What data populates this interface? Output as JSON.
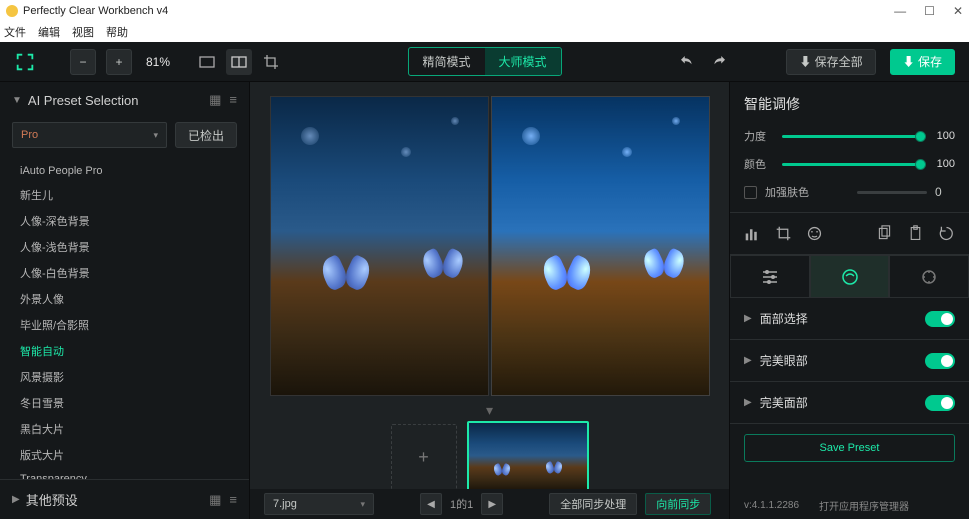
{
  "window": {
    "title": "Perfectly Clear Workbench v4"
  },
  "menubar": [
    "文件",
    "编辑",
    "视图",
    "帮助"
  ],
  "toolbar": {
    "zoom": "81%",
    "mode_simple": "精简模式",
    "mode_master": "大师模式",
    "save_all": "⬇ 保存全部",
    "save": "⬇ 保存"
  },
  "left": {
    "ai_title": "AI Preset Selection",
    "dropdown_value": "Pro",
    "detect_btn": "已检出",
    "presets": [
      {
        "label": "iAuto People Pro",
        "sel": false
      },
      {
        "label": "新生儿",
        "sel": false
      },
      {
        "label": "人像-深色背景",
        "sel": false
      },
      {
        "label": "人像-浅色背景",
        "sel": false
      },
      {
        "label": "人像-白色背景",
        "sel": false
      },
      {
        "label": "外景人像",
        "sel": false
      },
      {
        "label": "毕业照/合影照",
        "sel": false
      },
      {
        "label": "智能自动",
        "sel": true
      },
      {
        "label": "风景摄影",
        "sel": false
      },
      {
        "label": "冬日雪景",
        "sel": false
      },
      {
        "label": "黑白大片",
        "sel": false
      },
      {
        "label": "版式大片",
        "sel": false
      },
      {
        "label": "Transparency",
        "sel": false
      }
    ],
    "other_presets": "其他预设"
  },
  "center": {
    "filename": "7.jpg",
    "counter": "1的1",
    "sync_prev": "向前同步",
    "sync_all": "全部同步处理"
  },
  "right": {
    "title": "智能调修",
    "sliders": [
      {
        "label": "力度",
        "value": 100,
        "active": true
      },
      {
        "label": "颜色",
        "value": 100,
        "active": true
      }
    ],
    "skin_boost": "加强肤色",
    "skin_boost_value": 0,
    "sections": [
      {
        "label": "面部选择",
        "on": true
      },
      {
        "label": "完美眼部",
        "on": true
      },
      {
        "label": "完美面部",
        "on": true
      }
    ],
    "save_preset": "Save Preset",
    "version": "v:4.1.1.2286",
    "app_mgr": "打开应用程序管理器"
  }
}
